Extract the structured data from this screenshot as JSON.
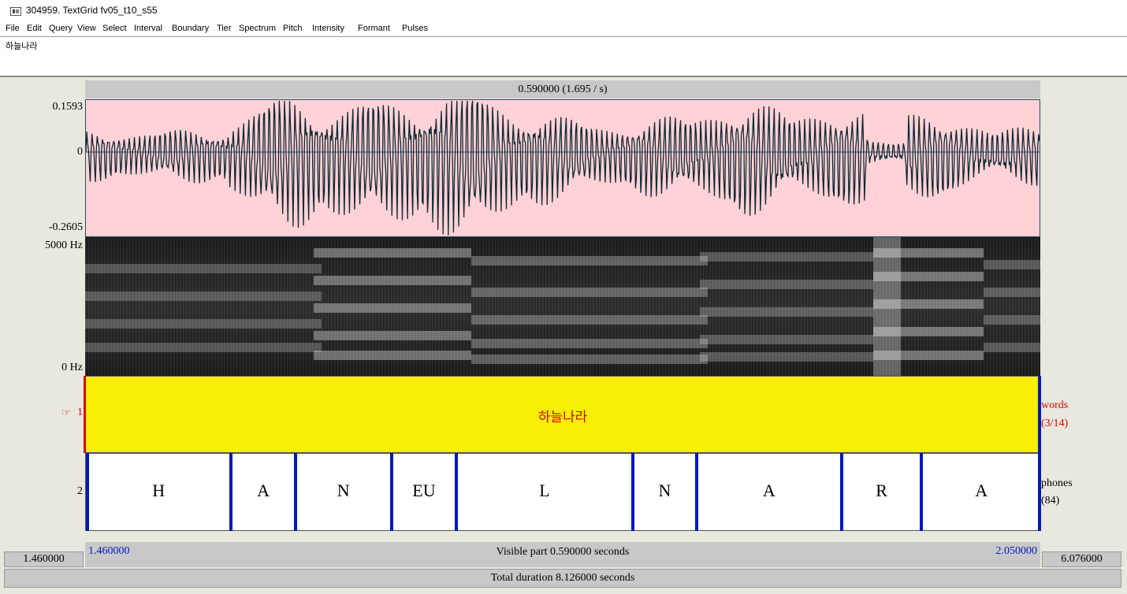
{
  "window": {
    "title": "304959. TextGrid fv05_t10_s55"
  },
  "menu": [
    "File",
    "Edit",
    "Query",
    "View",
    "Select",
    "Interval",
    "Boundary",
    "Tier",
    "Spectrum",
    "Pitch",
    "Intensity",
    "Formant",
    "Pulses"
  ],
  "utterance_text": "하늘나라",
  "selection_label": "0.590000 (1.695 / s)",
  "waveform": {
    "max_label": "0.1593",
    "zero_label": "0",
    "min_label": "-0.2605"
  },
  "spectrogram": {
    "top_label": "5000 Hz",
    "bottom_label": "0 Hz"
  },
  "tiers": [
    {
      "number": "1",
      "name": "words",
      "count": "(3/14)",
      "segments": [
        {
          "label": "하늘나라"
        }
      ]
    },
    {
      "number": "2",
      "name": "phones",
      "count": "(84)",
      "segments": [
        {
          "label": "H",
          "start": 1.46,
          "end": 1.5498
        },
        {
          "label": "A",
          "start": 1.5498,
          "end": 1.5893
        },
        {
          "label": "N",
          "start": 1.5893,
          "end": 1.6488
        },
        {
          "label": "EU",
          "start": 1.6488,
          "end": 1.6888
        },
        {
          "label": "L",
          "start": 1.6888,
          "end": 1.7978
        },
        {
          "label": "N",
          "start": 1.7978,
          "end": 1.8373
        },
        {
          "label": "A",
          "start": 1.8373,
          "end": 1.9267
        },
        {
          "label": "R",
          "start": 1.9267,
          "end": 1.9762
        },
        {
          "label": "A",
          "start": 1.9762,
          "end": 2.05
        }
      ]
    }
  ],
  "visible": {
    "start": "1.460000",
    "end": "2.050000",
    "label": "Visible part 0.590000 seconds"
  },
  "window_start": "1.460000",
  "window_end": "6.076000",
  "total_duration_label": "Total duration 8.126000 seconds",
  "colors": {
    "selection_yellow": "#f7ef04",
    "boundary_blue": "#0018c0",
    "tier_red": "#e00000",
    "wave_bg": "#ffd2d7"
  },
  "icons": {
    "app": "praat-window-icon",
    "tier_pointer": "pointing-hand-icon"
  }
}
